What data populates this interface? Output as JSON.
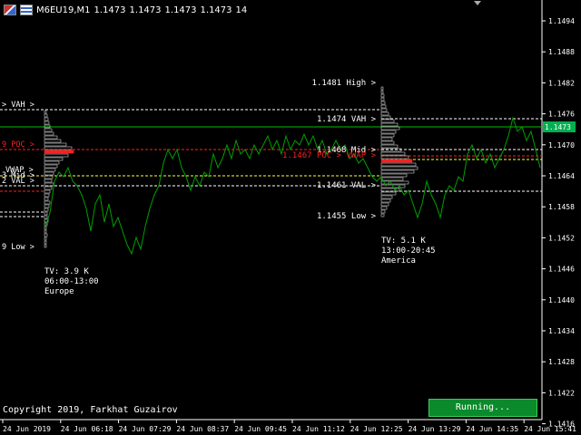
{
  "header": {
    "symbol_timeframe": "M6EU19,M1",
    "bid": "1.1473",
    "ohlc_high": "1.1473",
    "ohlc_low": "1.1473",
    "ohlc_close": "1.1473",
    "volume": "14"
  },
  "price_axis": {
    "ticks": [
      "1.1494",
      "1.1488",
      "1.1482",
      "1.1476",
      "1.1470",
      "1.1464",
      "1.1458",
      "1.1452",
      "1.1446",
      "1.1440",
      "1.1434",
      "1.1428",
      "1.1422",
      "1.1416"
    ],
    "current_price": "1.1473",
    "current_price_color": "#00b050"
  },
  "time_axis": {
    "ticks": [
      "24 Jun 2019",
      "24 Jun 06:18",
      "24 Jun 07:29",
      "24 Jun 08:37",
      "24 Jun 09:45",
      "24 Jun 11:12",
      "24 Jun 12:25",
      "24 Jun 13:29",
      "24 Jun 14:35",
      "24 Jun 15:41"
    ]
  },
  "sessions": {
    "left": {
      "labels": {
        "vah": "> VAH >",
        "poc": "9 POC >",
        "vwap": "VWAP >",
        "mid": "3 Mid >",
        "val": "2 VAL >",
        "low": "9 Low >"
      },
      "volume": "TV: 3.9 K",
      "hours": "06:00-13:00",
      "name": "Europe"
    },
    "right": {
      "labels": {
        "high": "1.1481 High >",
        "vah": "1.1474 VAH >",
        "mid": "1.1468 Mid >",
        "poc": "1.1467 POC > VWAP >",
        "val": "1.1461 VAL >",
        "low": "1.1455 Low >"
      },
      "volume": "TV: 5.1 K",
      "hours": "13:00-20:45",
      "name": "America"
    }
  },
  "colors": {
    "price_line": "#00a000",
    "poc": "#ff2020",
    "value_area": "#ffffff",
    "vwap": "#ffff40",
    "current_line": "#00c000"
  },
  "footer": {
    "copyright": "Copyright 2019, Farkhat Guzairov",
    "status_button": "Running..."
  }
}
